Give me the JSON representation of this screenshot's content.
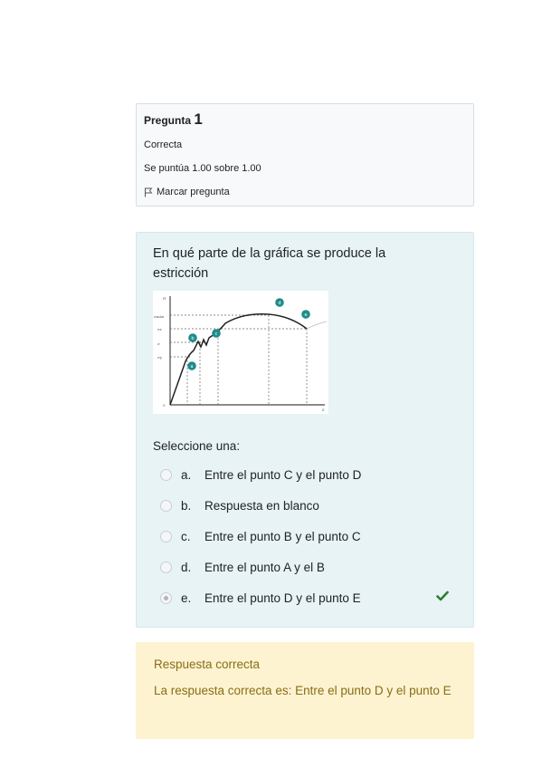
{
  "question_info": {
    "label": "Pregunta",
    "number": "1",
    "state": "Correcta",
    "grade": "Se puntúa 1.00 sobre 1.00",
    "flag_label": "Marcar pregunta"
  },
  "question": {
    "text": "En qué parte de la gráfica se produce la estricción",
    "prompt": "Seleccione una:",
    "options": [
      {
        "letter": "a.",
        "text": "Entre el punto C y el punto D",
        "selected": false
      },
      {
        "letter": "b.",
        "text": "Respuesta en blanco",
        "selected": false
      },
      {
        "letter": "c.",
        "text": "Entre el punto B y el punto C",
        "selected": false
      },
      {
        "letter": "d.",
        "text": "Entre el punto A y el B",
        "selected": false
      },
      {
        "letter": "e.",
        "text": "Entre el punto D y el punto E",
        "selected": true
      }
    ],
    "correct_icon": "check-icon",
    "graph": {
      "marker_labels": [
        "a",
        "b",
        "c",
        "d",
        "e"
      ],
      "y_labels": [
        "σ",
        "σmáx",
        "σr",
        "σ",
        "σy",
        "0"
      ],
      "x_label": "ε"
    }
  },
  "feedback": {
    "title": "Respuesta correcta",
    "text": "La respuesta correcta es: Entre el punto D y el punto E"
  },
  "colors": {
    "question_bg": "#e7f3f5",
    "feedback_bg": "#fdf3d1",
    "feedback_text": "#8a6d14",
    "check": "#357a32",
    "marker": "#1f8a8a"
  }
}
